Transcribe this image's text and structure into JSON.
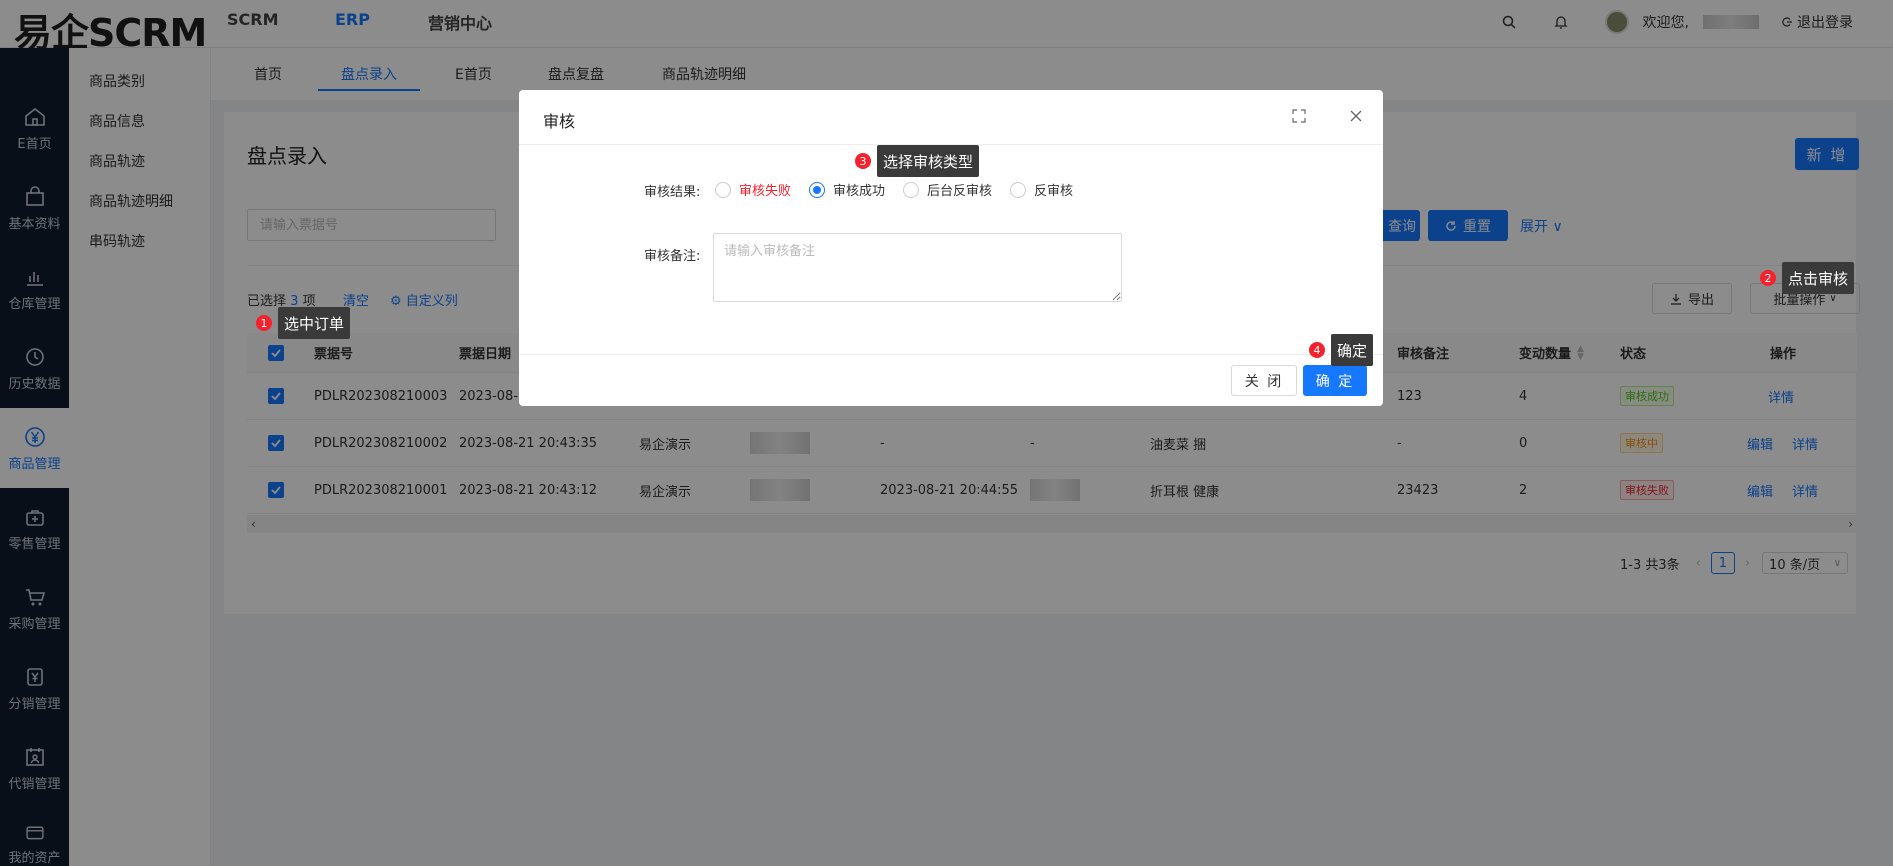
{
  "header": {
    "logo": "易企SCRM",
    "nav": [
      "SCRM",
      "ERP",
      "营销中心"
    ],
    "welcome": "欢迎您,",
    "logout": "退出登录"
  },
  "rail": [
    {
      "label": "E首页",
      "icon": "home-icon"
    },
    {
      "label": "基本资料",
      "icon": "bag-icon"
    },
    {
      "label": "仓库管理",
      "icon": "bar-chart-icon"
    },
    {
      "label": "历史数据",
      "icon": "clock-icon"
    },
    {
      "label": "商品管理",
      "icon": "yen-circle-icon"
    },
    {
      "label": "零售管理",
      "icon": "retail-bag-icon"
    },
    {
      "label": "采购管理",
      "icon": "cart-icon"
    },
    {
      "label": "分销管理",
      "icon": "distribution-icon"
    },
    {
      "label": "代销管理",
      "icon": "calendar-user-icon"
    },
    {
      "label": "我的资产",
      "icon": "wallet-icon"
    }
  ],
  "submenu": [
    "商品类别",
    "商品信息",
    "商品轨迹",
    "商品轨迹明细",
    "串码轨迹"
  ],
  "tabs": [
    "首页",
    "盘点录入",
    "E首页",
    "盘点复盘",
    "商品轨迹明细"
  ],
  "page": {
    "title": "盘点录入",
    "new_label": "新 增",
    "search_placeholder": "请输入票据号",
    "query_label": "查询",
    "reset_label": "重置",
    "expand_label": "展开",
    "selected_prefix": "已选择",
    "selected_count": "3",
    "selected_suffix": "项",
    "clear_label": "清空",
    "custom_cols_label": "自定义列",
    "export_label": "导出",
    "batch_label": "批量操作"
  },
  "table": {
    "headers": {
      "ticket": "票据号",
      "date": "票据日期",
      "remark": "审核备注",
      "qty": "变动数量",
      "status": "状态",
      "ops": "操作"
    },
    "rows": [
      {
        "ticket": "PDLR202308210003",
        "date": "2023-08-",
        "company": "",
        "audit_time": "",
        "dash": "",
        "goods": "",
        "remark": "123",
        "qty": "4",
        "status": "审核成功",
        "status_kind": "ok",
        "ops": [
          "详情"
        ]
      },
      {
        "ticket": "PDLR202308210002",
        "date": "2023-08-21 20:43:35",
        "company": "易企演示",
        "audit_time": "-",
        "dash": "-",
        "goods": "油麦菜 捆",
        "remark": "-",
        "qty": "0",
        "status": "审核中",
        "status_kind": "mid",
        "ops": [
          "编辑",
          "详情"
        ]
      },
      {
        "ticket": "PDLR202308210001",
        "date": "2023-08-21 20:43:12",
        "company": "易企演示",
        "audit_time": "2023-08-21 20:44:55",
        "dash": "",
        "goods": "折耳根 健康",
        "remark": "23423",
        "qty": "2",
        "status": "审核失败",
        "status_kind": "fail",
        "ops": [
          "编辑",
          "详情"
        ]
      }
    ]
  },
  "pagination": {
    "summary": "1-3 共3条",
    "current": "1",
    "page_size": "10 条/页"
  },
  "modal": {
    "title": "审核",
    "result_label": "审核结果:",
    "options": [
      "审核失败",
      "审核成功",
      "后台反审核",
      "反审核"
    ],
    "selected_option": "审核成功",
    "remark_label": "审核备注:",
    "remark_placeholder": "请输入审核备注",
    "close_label": "关 闭",
    "ok_label": "确 定"
  },
  "callouts": [
    {
      "num": "1",
      "text": "选中订单"
    },
    {
      "num": "2",
      "text": "点击审核"
    },
    {
      "num": "3",
      "text": "选择审核类型"
    },
    {
      "num": "4",
      "text": "确定"
    }
  ],
  "colors": {
    "primary": "#1677ff",
    "rail_bg": "#0f1c2e",
    "danger": "#f5222d"
  }
}
